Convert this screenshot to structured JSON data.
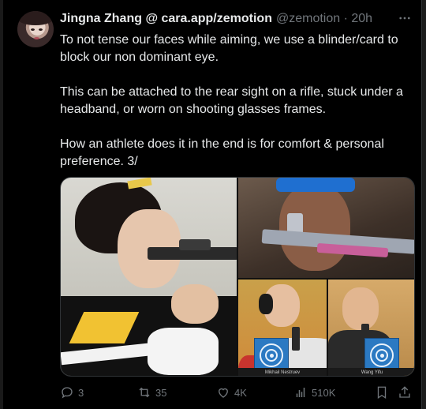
{
  "author": {
    "name": "Jingna Zhang @ cara.app/zemotion",
    "handle": "@zemotion",
    "separator": "·",
    "time": "20h",
    "more_icon": "more-horizontal-icon"
  },
  "post": {
    "paragraphs": [
      "To not tense our faces while aiming, we use a blinder/card to block our non dominant eye.",
      "This can be attached to the rear sight on a rifle, stuck under a headband, or worn on shooting glasses frames.",
      "How an athlete does it in the end is for comfort & personal preference. 3/"
    ]
  },
  "media": {
    "captions": [
      "Mikhail Nestruev",
      "Wang Yifu"
    ]
  },
  "actions": {
    "replies": "3",
    "reposts": "35",
    "likes": "4K",
    "views": "510K"
  },
  "colors": {
    "background": "#000000",
    "text": "#e7e9ea",
    "muted": "#71767b"
  }
}
